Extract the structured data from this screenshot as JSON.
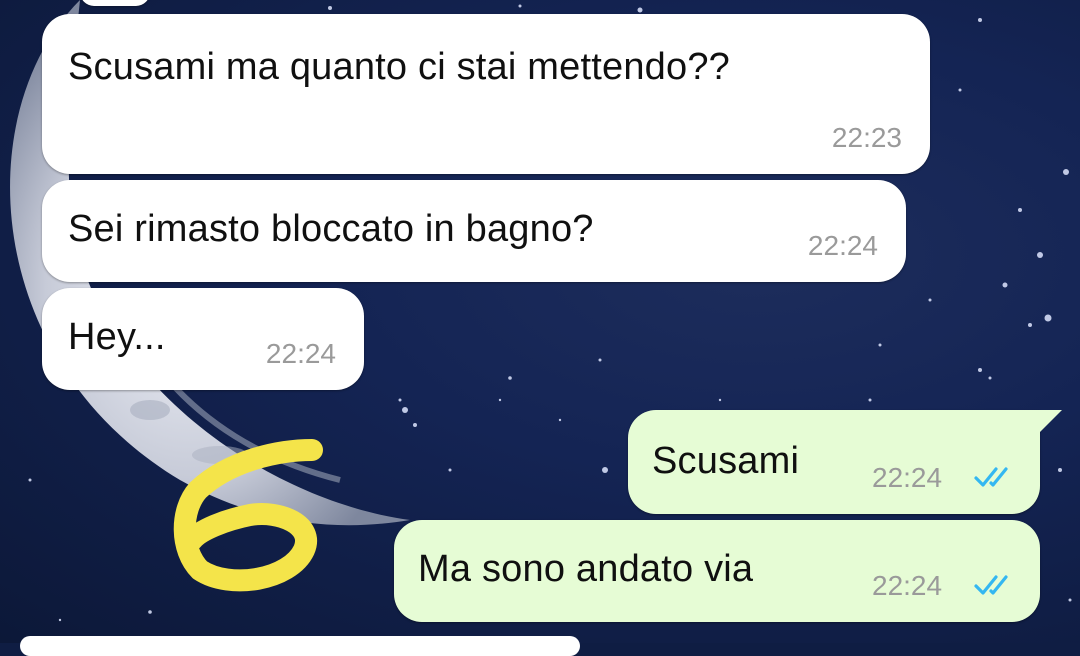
{
  "chat": {
    "messages": [
      {
        "direction": "incoming",
        "text": "Scusami ma quanto ci stai mettendo??",
        "time": "22:23"
      },
      {
        "direction": "incoming",
        "text": "Sei rimasto bloccato in bagno?",
        "time": "22:24"
      },
      {
        "direction": "incoming",
        "text": "Hey...",
        "time": "22:24"
      },
      {
        "direction": "outgoing",
        "text": "Scusami",
        "time": "22:24",
        "status": "read"
      },
      {
        "direction": "outgoing",
        "text": "Ma sono andato via",
        "time": "22:24",
        "status": "read"
      }
    ]
  },
  "colors": {
    "incoming_bubble": "#ffffff",
    "outgoing_bubble": "#e6fcd5",
    "read_ticks": "#34b7f1",
    "timestamp": "#9a9a9a",
    "wallpaper": "#142454",
    "doodle": "#f4e44a"
  },
  "icons": {
    "read_receipt": "double-check-icon",
    "drawing": "hand-drawn-number-6"
  }
}
